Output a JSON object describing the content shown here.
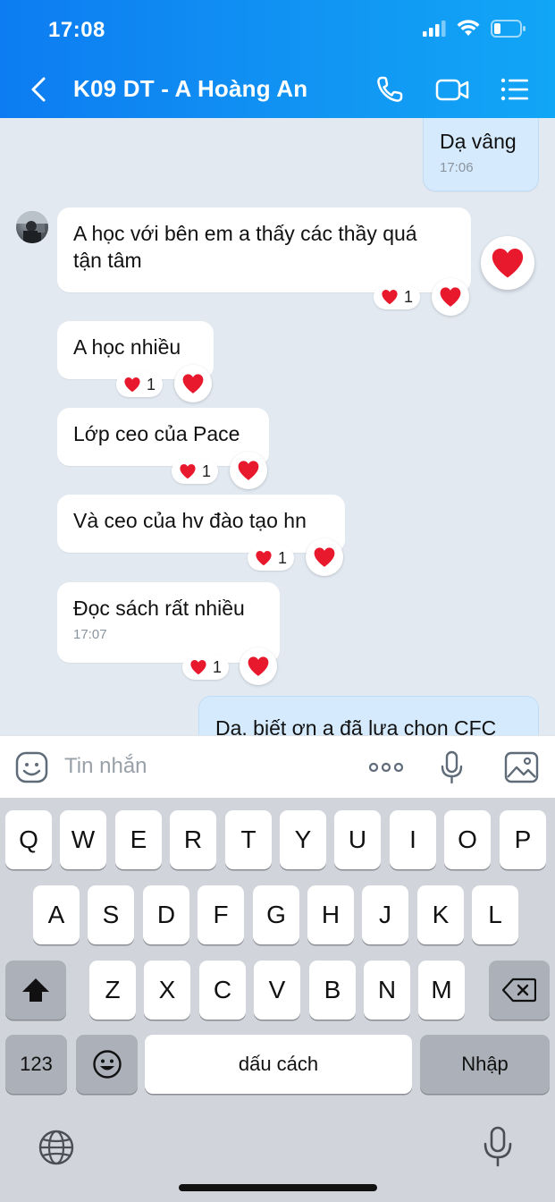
{
  "status_bar": {
    "time": "17:08"
  },
  "header": {
    "title": "K09 DT - A Hoàng An",
    "back_icon": "chevron-left-icon"
  },
  "messages": {
    "m0": {
      "text": "Dạ vâng",
      "time": "17:06"
    },
    "m1": {
      "text_line1": "A học với bên em a thấy các thầy quá",
      "text_line2": "tận tâm",
      "reaction_count": "1"
    },
    "m2": {
      "text": "A học nhiều",
      "reaction_count": "1"
    },
    "m3": {
      "text": "Lớp ceo của Pace",
      "reaction_count": "1"
    },
    "m4": {
      "text": "Và ceo của hv đào tạo hn",
      "reaction_count": "1"
    },
    "m5": {
      "text": "Đọc sách rất nhiều",
      "time": "17:07",
      "reaction_count": "1"
    },
    "m6": {
      "text": "Dạ, biết ơn a đã lựa chọn CFC"
    }
  },
  "input": {
    "placeholder": "Tin nhắn"
  },
  "keyboard": {
    "row1": [
      "Q",
      "W",
      "E",
      "R",
      "T",
      "Y",
      "U",
      "I",
      "O",
      "P"
    ],
    "row2": [
      "A",
      "S",
      "D",
      "F",
      "G",
      "H",
      "J",
      "K",
      "L"
    ],
    "row3": [
      "Z",
      "X",
      "C",
      "V",
      "B",
      "N",
      "M"
    ],
    "numbers_key": "123",
    "space_key": "dấu cách",
    "return_key": "Nhập"
  },
  "colors": {
    "header": "#0d7cf2",
    "heart": "#e8192c",
    "my_bubble": "#d5eafd",
    "chat_bg": "#e2e9f1"
  }
}
